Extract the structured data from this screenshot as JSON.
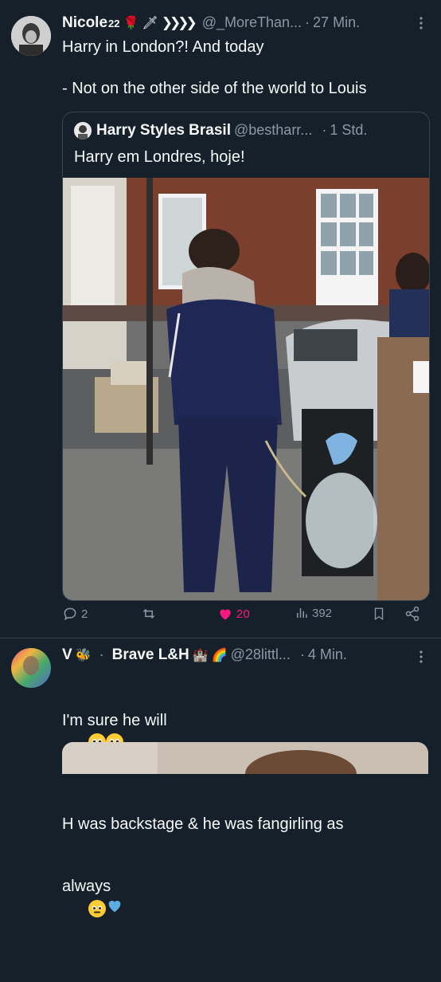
{
  "tweet1": {
    "display_name": "Nicole",
    "superscript": "22",
    "handle": "@_MoreThan...",
    "separator": "·",
    "time": "27 Min.",
    "text": "Harry in London?! And today\n\n- Not on the other side of the world to Louis",
    "quote": {
      "name": "Harry Styles Brasil",
      "handle": "@bestharr...",
      "separator": "·",
      "time": "1 Std.",
      "text": "Harry em Londres, hoje!"
    },
    "actions": {
      "replies": "2",
      "reposts": "",
      "likes": "20",
      "views": "392"
    },
    "colors": {
      "like": "#f91880"
    }
  },
  "tweet2": {
    "display_name": "V",
    "separator_dot": "·",
    "display_name_2": "Brave L&H",
    "handle": "@28littl...",
    "separator": "·",
    "time": "4 Min.",
    "line1": "I'm sure he will",
    "line2": "H was backstage & he was fangirling as",
    "line3": "always"
  },
  "icons": {
    "more": "more-dots-icon",
    "reply": "reply-icon",
    "repost": "repost-icon",
    "like": "heart-icon",
    "views": "views-icon",
    "bookmark": "bookmark-icon",
    "share": "share-icon"
  }
}
